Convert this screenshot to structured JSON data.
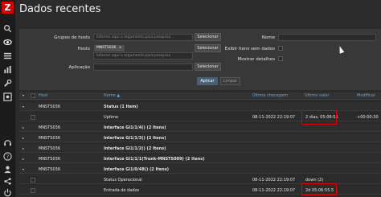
{
  "app": {
    "logo": "Z",
    "title": "Dados recentes"
  },
  "sidebar": {
    "icons": [
      "search-icon",
      "eye-icon",
      "list-icon",
      "chart-icon",
      "wrench-icon",
      "gear-icon",
      "headset-icon",
      "help-icon",
      "user-icon",
      "share-icon",
      "power-icon"
    ]
  },
  "filter": {
    "host_groups_label": "Grupos de hosts",
    "host_groups_placeholder": "Informe aqui o argumento para pesquisa",
    "hosts_label": "Hosts",
    "hosts_chip": "MNSTS036",
    "hosts_chip_remove": "×",
    "hosts_placeholder": "Informe aqui o argumento para pesquisa",
    "application_label": "Aplicação",
    "select_label": "Selecionar",
    "name_label": "Nome",
    "show_items_label": "Exibir itens sem dados",
    "show_details_label": "Mostrar detalhes",
    "apply_label": "Aplicar",
    "reset_label": "Limpar"
  },
  "table": {
    "headers": {
      "host": "Host",
      "name": "Nome ▲",
      "last_check": "Última checagem",
      "last_value": "Último valor",
      "change": "Modificar"
    },
    "rows": [
      {
        "type": "host",
        "host": "MNSTS036",
        "name": "Status (1 Item)",
        "last_check": "",
        "last_value": "",
        "change": ""
      },
      {
        "type": "item",
        "host": "",
        "name": "Uptime",
        "last_check": "08-11-2022 22:19:07",
        "last_value": "2 dias, 05:06:55",
        "change": "+00:00:30"
      },
      {
        "type": "host",
        "host": "MNSTS036",
        "name": "Interface Gi1/1/4() (2 Itens)",
        "last_check": "",
        "last_value": "",
        "change": ""
      },
      {
        "type": "host",
        "host": "MNSTS036",
        "name": "Interface Gi1/1/3() (2 Itens)",
        "last_check": "",
        "last_value": "",
        "change": ""
      },
      {
        "type": "host",
        "host": "MNSTS036",
        "name": "Interface Gi1/1/2() (2 Itens)",
        "last_check": "",
        "last_value": "",
        "change": ""
      },
      {
        "type": "host",
        "host": "MNSTS036",
        "name": "Interface Gi1/1/1(Trunk-MNSTS009) (2 Itens)",
        "last_check": "",
        "last_value": "",
        "change": ""
      },
      {
        "type": "host",
        "host": "MNSTS036",
        "name": "Interface Gi1/0/48() (2 Itens)",
        "last_check": "",
        "last_value": "",
        "change": ""
      },
      {
        "type": "item",
        "host": "",
        "name": "Status Operacional",
        "last_check": "08-11-2022 22:19:07",
        "last_value": "down (2)",
        "change": ""
      },
      {
        "type": "item",
        "host": "",
        "name": "Entrada de dados",
        "last_check": "08-11-2022 22:19:07",
        "last_value": "2d 05:06:55.5",
        "change": ""
      }
    ]
  },
  "colors": {
    "accent": "#5fa8d9",
    "highlight": "#e00000",
    "logo": "#d40000"
  }
}
